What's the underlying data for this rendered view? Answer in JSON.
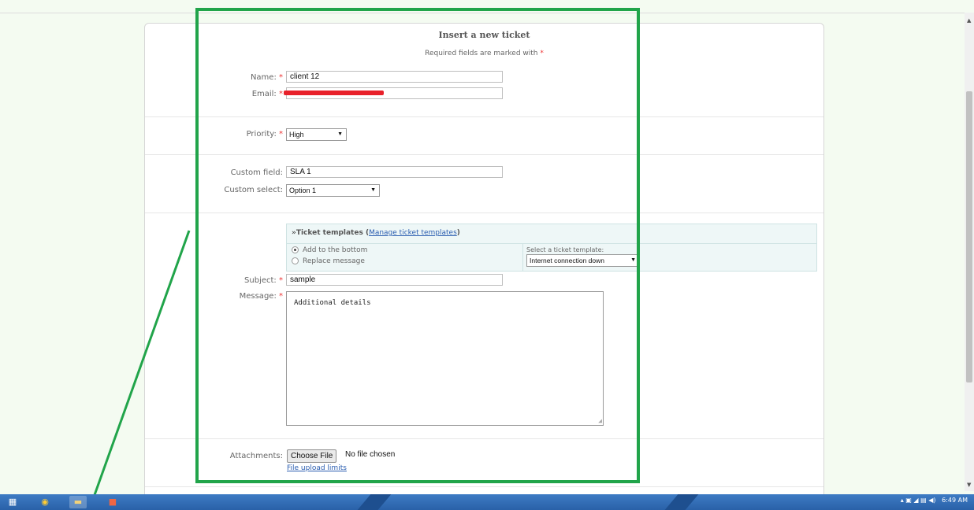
{
  "form": {
    "title": "Insert a new ticket",
    "required_note": "Required fields are marked with",
    "required_mark": "*",
    "name_label": "Name:",
    "name_value": "client  12",
    "email_label": "Email:",
    "email_value": "c",
    "priority_label": "Priority:",
    "priority_value": "High",
    "custom_field_label": "Custom field:",
    "custom_field_value": "SLA 1",
    "custom_select_label": "Custom select:",
    "custom_select_value": "Option 1",
    "templates": {
      "title": "»Ticket templates",
      "manage_link": "Manage ticket templates",
      "radio_bottom": "Add to the bottom",
      "radio_replace": "Replace message",
      "select_label": "Select a ticket template:",
      "select_value": "Internet connection down"
    },
    "subject_label": "Subject:",
    "subject_value": "sample",
    "message_label": "Message:",
    "message_value": "Additional details",
    "attachments_label": "Attachments:",
    "choose_file": "Choose File",
    "no_file": "No file chosen",
    "upload_limits": "File upload limits"
  },
  "taskbar": {
    "clock": "6:49 AM"
  },
  "colors": {
    "annotation_green": "#21a44a",
    "required_red": "#e33333",
    "link_blue": "#2a5db0"
  }
}
